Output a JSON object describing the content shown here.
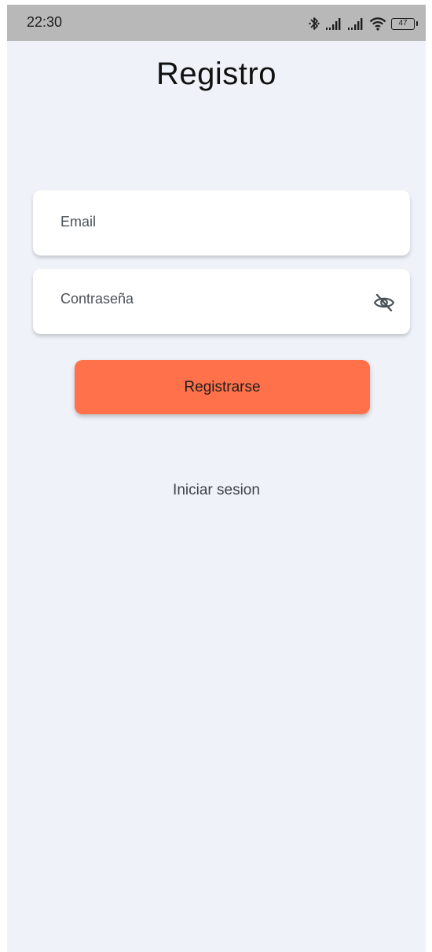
{
  "status_bar": {
    "time": "22:30",
    "battery_level": "47",
    "icons": [
      "bluetooth-icon",
      "signal-icon",
      "signal-icon",
      "wifi-icon",
      "battery-icon"
    ]
  },
  "page": {
    "title": "Registro"
  },
  "form": {
    "email_placeholder": "Email",
    "password_placeholder": "Contraseña",
    "password_toggle_icon": "eye-off-icon",
    "submit_label": "Registrarse"
  },
  "footer": {
    "login_link": "Iniciar sesion"
  },
  "colors": {
    "background": "#eff2f8",
    "accent": "#ff714a",
    "status_bar": "#b8b8b8",
    "field": "#ffffff"
  }
}
